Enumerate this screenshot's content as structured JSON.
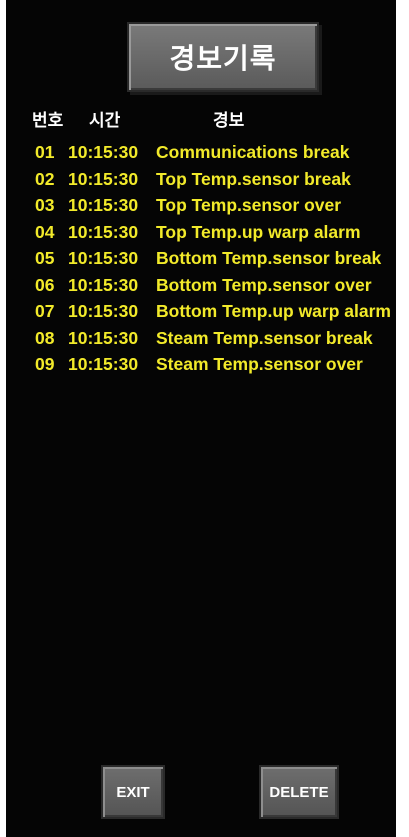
{
  "title": "경보기록",
  "headers": {
    "number": "번호",
    "time": "시간",
    "alarm": "경보"
  },
  "alarms": [
    {
      "no": "01",
      "time": "10:15:30",
      "message": "Communications break"
    },
    {
      "no": "02",
      "time": "10:15:30",
      "message": "Top Temp.sensor break"
    },
    {
      "no": "03",
      "time": "10:15:30",
      "message": "Top Temp.sensor over"
    },
    {
      "no": "04",
      "time": "10:15:30",
      "message": "Top Temp.up warp alarm"
    },
    {
      "no": "05",
      "time": "10:15:30",
      "message": "Bottom Temp.sensor break"
    },
    {
      "no": "06",
      "time": "10:15:30",
      "message": "Bottom Temp.sensor over"
    },
    {
      "no": "07",
      "time": "10:15:30",
      "message": "Bottom Temp.up warp alarm"
    },
    {
      "no": "08",
      "time": "10:15:30",
      "message": "Steam Temp.sensor break"
    },
    {
      "no": "09",
      "time": "10:15:30",
      "message": "Steam Temp.sensor over"
    }
  ],
  "buttons": {
    "exit": "EXIT",
    "delete": "DELETE"
  },
  "colors": {
    "background": "#050505",
    "alarm_text": "#f2ea2a",
    "button": "#606060"
  }
}
